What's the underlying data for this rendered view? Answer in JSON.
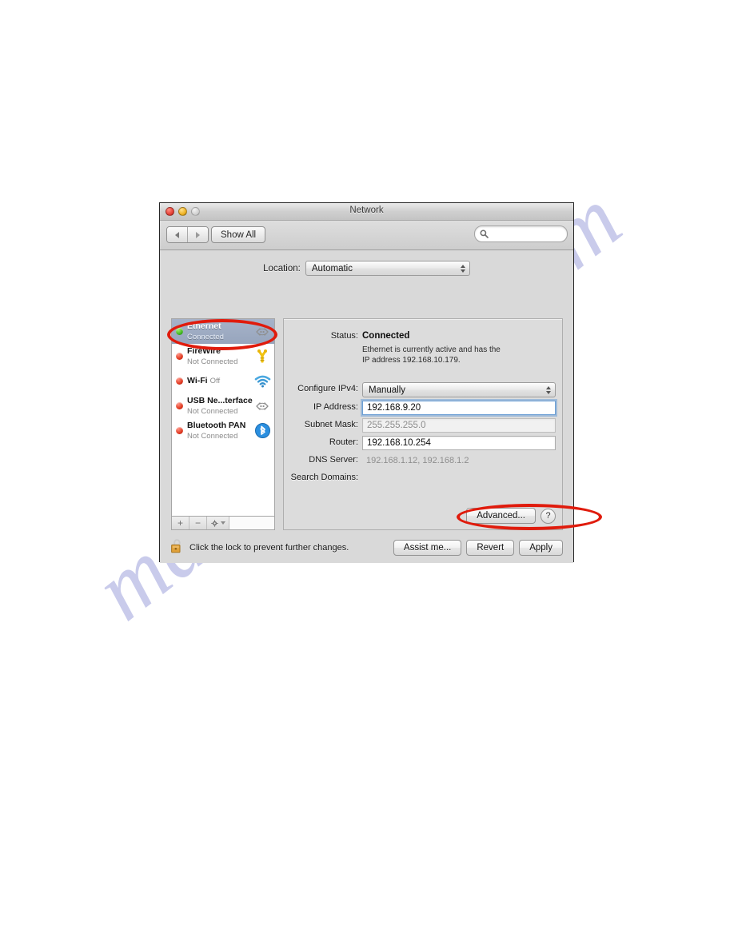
{
  "watermark": {
    "text": "manualshive.com"
  },
  "window": {
    "title": "Network",
    "traffic_lights": [
      "close",
      "minimize",
      "zoom"
    ],
    "toolbar": {
      "back_label": "back",
      "forward_label": "forward",
      "show_all_label": "Show All",
      "search_placeholder": "",
      "search_value": ""
    }
  },
  "location": {
    "label": "Location:",
    "value": "Automatic"
  },
  "sidebar": {
    "interfaces": [
      {
        "name": "Ethernet",
        "state": "Connected",
        "status_color": "green",
        "icon": "ethernet-icon",
        "selected": true
      },
      {
        "name": "FireWire",
        "state": "Not Connected",
        "status_color": "red",
        "icon": "firewire-icon",
        "selected": false
      },
      {
        "name": "Wi-Fi",
        "state": "Off",
        "status_color": "red",
        "icon": "wifi-icon",
        "selected": false
      },
      {
        "name": "USB Ne...terface",
        "state": "Not Connected",
        "status_color": "red",
        "icon": "ethernet-icon",
        "selected": false
      },
      {
        "name": "Bluetooth PAN",
        "state": "Not Connected",
        "status_color": "red",
        "icon": "bluetooth-icon",
        "selected": false
      }
    ],
    "toolbar": {
      "add_label": "+",
      "remove_label": "−",
      "action_label": "gear"
    }
  },
  "details": {
    "status_label": "Status:",
    "status_value": "Connected",
    "status_description": "Ethernet is currently active and has the IP address 192.168.10.179.",
    "fields": [
      {
        "label": "Configure IPv4:",
        "value": "Manually",
        "kind": "popup"
      },
      {
        "label": "IP Address:",
        "value": "192.168.9.20",
        "kind": "text",
        "focused": true
      },
      {
        "label": "Subnet Mask:",
        "value": "255.255.255.0",
        "kind": "text",
        "faded": true
      },
      {
        "label": "Router:",
        "value": "192.168.10.254",
        "kind": "text"
      },
      {
        "label": "DNS Server:",
        "value": "192.168.1.12, 192.168.1.2",
        "kind": "plain"
      },
      {
        "label": "Search Domains:",
        "value": "",
        "kind": "plain"
      }
    ],
    "advanced_label": "Advanced...",
    "help_label": "?"
  },
  "footer": {
    "lock_text": "Click the lock to prevent further changes.",
    "lock_icon": "unlocked-padlock-icon",
    "buttons": [
      {
        "label": "Assist me..."
      },
      {
        "label": "Revert"
      },
      {
        "label": "Apply"
      }
    ]
  },
  "annotations": {
    "color": "#e01b0c",
    "highlights": [
      "ethernet-sidebar-item",
      "router-field"
    ]
  }
}
